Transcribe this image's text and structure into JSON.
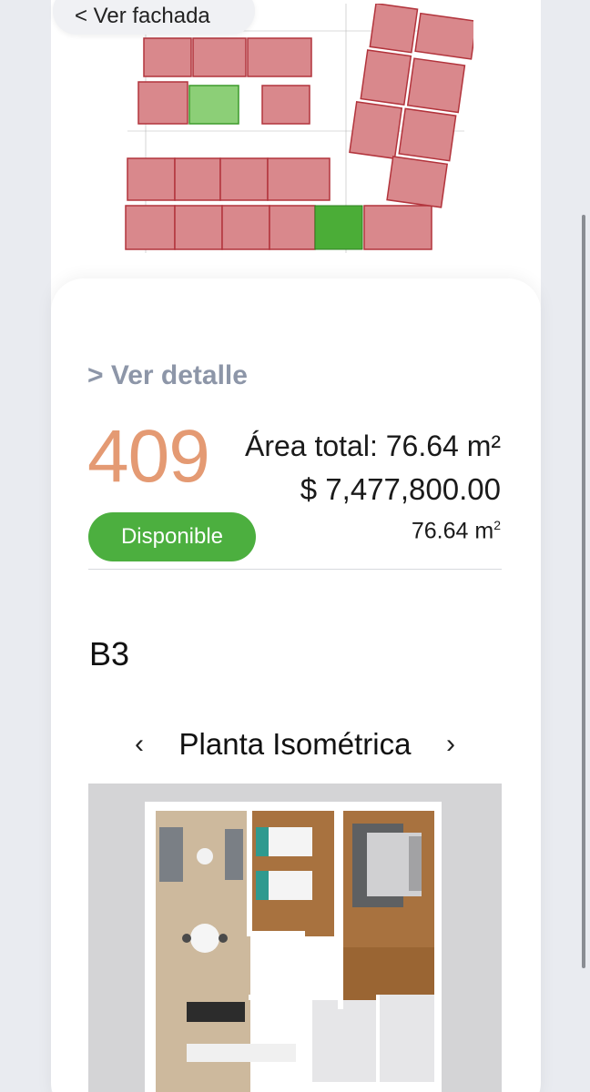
{
  "header": {
    "facade_link": "< Ver fachada"
  },
  "unit": {
    "detail_link": "> Ver detalle",
    "number": "409",
    "area_total": "Área total: 76.64 m²",
    "price": "$ 7,477,800.00",
    "status": "Disponible",
    "area_value": "76.64 m",
    "area_unit_sup": "2",
    "model": "B3"
  },
  "gallery": {
    "prev_icon": "‹",
    "next_icon": "›",
    "view_title": "Planta Isométrica"
  },
  "colors": {
    "unit_number": "#e49a73",
    "status_available": "#4caf3f",
    "siteplan_unit": "#d98a8e",
    "siteplan_selected": "#8ccf77",
    "siteplan_amenity": "#4bad37"
  }
}
